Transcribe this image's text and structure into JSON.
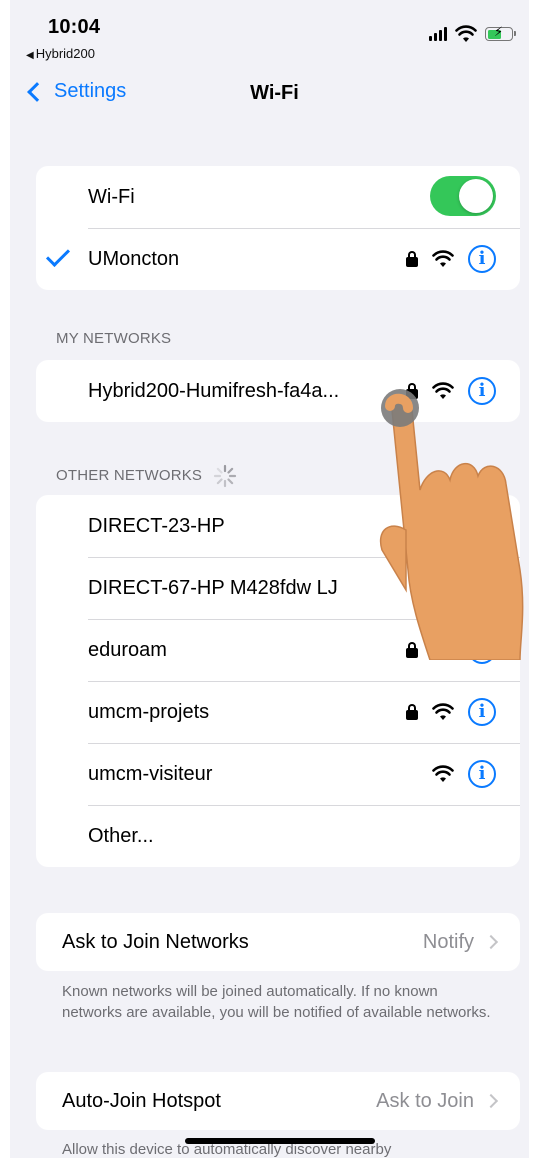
{
  "status_bar": {
    "time": "10:04",
    "back_app": "Hybrid200"
  },
  "nav": {
    "back_label": "Settings",
    "title": "Wi-Fi"
  },
  "wifi_toggle": {
    "label": "Wi-Fi",
    "state": "on"
  },
  "connected": {
    "name": "UMoncton"
  },
  "my_networks": {
    "header": "MY NETWORKS",
    "items": [
      {
        "name": "Hybrid200-Humifresh-fa4a..."
      }
    ]
  },
  "other_networks": {
    "header": "OTHER NETWORKS",
    "items": [
      {
        "name": "DIRECT-23-HP"
      },
      {
        "name": "DIRECT-67-HP M428fdw LJ"
      },
      {
        "name": "eduroam"
      },
      {
        "name": "umcm-projets"
      },
      {
        "name": "umcm-visiteur"
      },
      {
        "name": "Other..."
      }
    ]
  },
  "ask_to_join": {
    "label": "Ask to Join Networks",
    "value": "Notify",
    "footnote": "Known networks will be joined automatically. If no known networks are available, you will be notified of available networks."
  },
  "auto_join": {
    "label": "Auto-Join Hotspot",
    "value": "Ask to Join",
    "footnote": "Allow this device to automatically discover nearby"
  },
  "colors": {
    "accent": "#0a7aff",
    "toggle_on": "#34c759",
    "background": "#f2f2f7",
    "hand": "#e8a062"
  },
  "icons": [
    "lock-icon",
    "wifi-icon",
    "info-icon",
    "checkmark-icon",
    "spinner-icon",
    "chevron-right-icon"
  ]
}
